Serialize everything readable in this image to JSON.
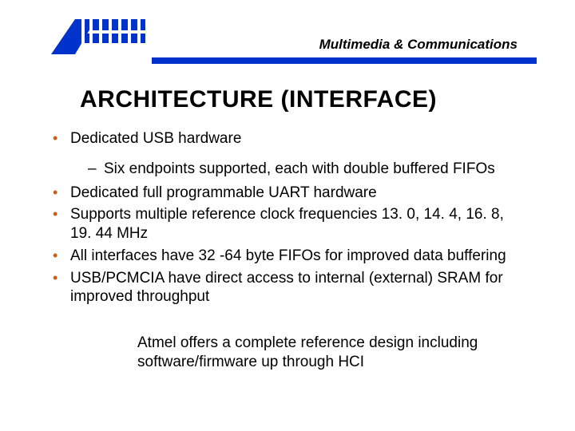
{
  "header": {
    "section_label": "Multimedia & Communications"
  },
  "title": "ARCHITECTURE (INTERFACE)",
  "bullets": {
    "b1": "Dedicated USB hardware",
    "b1_sub1": "Six endpoints supported, each with double buffered FIFOs",
    "b2": "Dedicated full programmable UART hardware",
    "b3": "Supports multiple reference clock frequencies 13. 0, 14. 4, 16. 8, 19. 44 MHz",
    "b4": "All interfaces have 32 -64 byte FIFOs for improved data buffering",
    "b5": "USB/PCMCIA have direct access to internal (external) SRAM for improved throughput"
  },
  "footer": "Atmel offers a complete reference design including software/firmware up through HCI"
}
